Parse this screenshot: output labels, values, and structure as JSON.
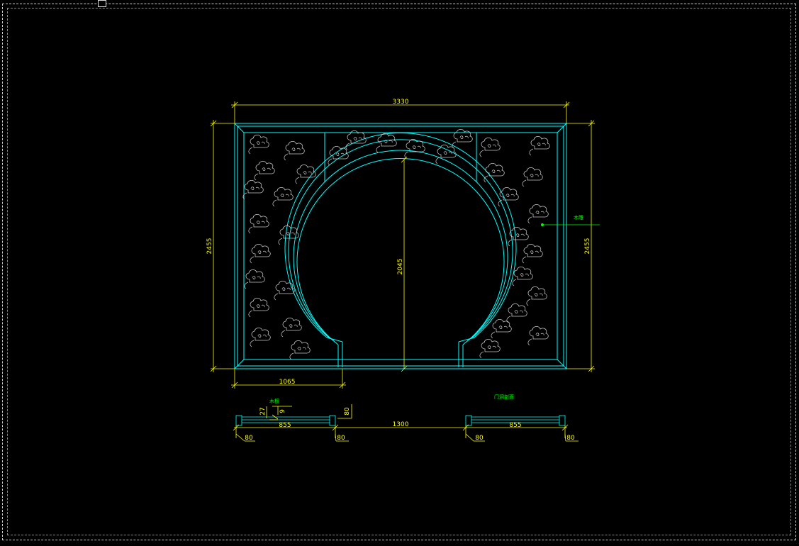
{
  "colors": {
    "background": "#000000",
    "dimension": "#ffff00",
    "outline": "#00ffff",
    "cloud": "#c8c8c8",
    "annotation": "#00ff00"
  },
  "dimensions": {
    "total_width": "3330",
    "total_height_left": "2455",
    "total_height_right": "2455",
    "arch_height": "2045",
    "base_left_width": "1065",
    "section_span": "1300",
    "section_left_inner": "855",
    "section_right_inner": "855",
    "section_left_end_a": "80",
    "section_left_end_b": "80",
    "section_right_end_a": "80",
    "section_right_end_b": "80",
    "section_height": "80",
    "detail_a": "27",
    "detail_b": "9"
  },
  "annotations": {
    "material_note": "木雕",
    "section_title": "门洞剖面",
    "section_note": "木板"
  },
  "icons": {
    "cloud_pattern": "auspicious-cloud-carving-icon",
    "leader_arrow": "leader-arrow-icon"
  }
}
